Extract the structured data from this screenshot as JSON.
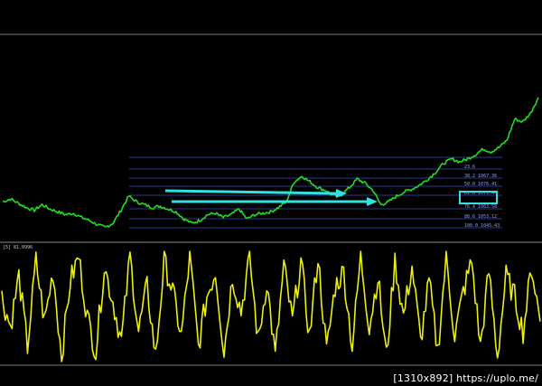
{
  "colors": {
    "background": "#000000",
    "price_line": "#22dd22",
    "indicator_line": "#eeee11",
    "fib_line": "#3c4dbb",
    "arrow": "#33e0e0",
    "highlight_box": "#33e0e0",
    "panel_divider": "#8a8a8a"
  },
  "indicator": {
    "label": "[5] 81.0996"
  },
  "fibonacci_levels": [
    {
      "label": "23.6"
    },
    {
      "label": "38.2  1067.36"
    },
    {
      "label": "50.0  1076.41"
    },
    {
      "label": "61.8  1071.44"
    },
    {
      "label": "76.4  1063.58"
    },
    {
      "label": "88.6  1053.12"
    },
    {
      "label": "100.0  1045.43"
    }
  ],
  "footer": {
    "watermark": "[1310x892] https://uplo.me/"
  },
  "chart_data": {
    "type": "line",
    "title": "",
    "xlabel": "",
    "ylabel": "",
    "grid": false,
    "series": [
      {
        "values": [
          1062,
          1064,
          1061,
          1058,
          1056,
          1060,
          1057,
          1055,
          1053,
          1054,
          1051,
          1049,
          1046,
          1044,
          1047,
          1056,
          1066,
          1062,
          1060,
          1058,
          1059,
          1057,
          1055,
          1050,
          1047,
          1049,
          1053,
          1054,
          1051,
          1053,
          1057,
          1050,
          1053,
          1054,
          1055,
          1058,
          1062,
          1076,
          1080,
          1076,
          1072,
          1070,
          1066,
          1067,
          1072,
          1078,
          1075,
          1070,
          1060,
          1062,
          1066,
          1069,
          1071,
          1074,
          1078,
          1083,
          1089,
          1092,
          1090,
          1092,
          1095,
          1099,
          1097,
          1100,
          1105,
          1120,
          1118,
          1124,
          1135
        ]
      },
      {
        "values": [
          2,
          -4,
          6,
          -8,
          9,
          -3,
          7,
          -10,
          5,
          10,
          -2,
          -9,
          8,
          1,
          -7,
          10,
          -5,
          4,
          -10,
          9,
          3,
          -6,
          10,
          -8,
          2,
          7,
          -9,
          6,
          -1,
          10,
          -7,
          5,
          -10,
          8,
          -3,
          9,
          -6,
          10,
          -9,
          4,
          7,
          -8,
          10,
          -4,
          6,
          -10,
          9,
          -2,
          8,
          -7,
          5,
          -9,
          10,
          -6,
          3,
          9,
          -8,
          7,
          -10,
          6,
          2,
          -5,
          8,
          -3
        ]
      }
    ]
  }
}
